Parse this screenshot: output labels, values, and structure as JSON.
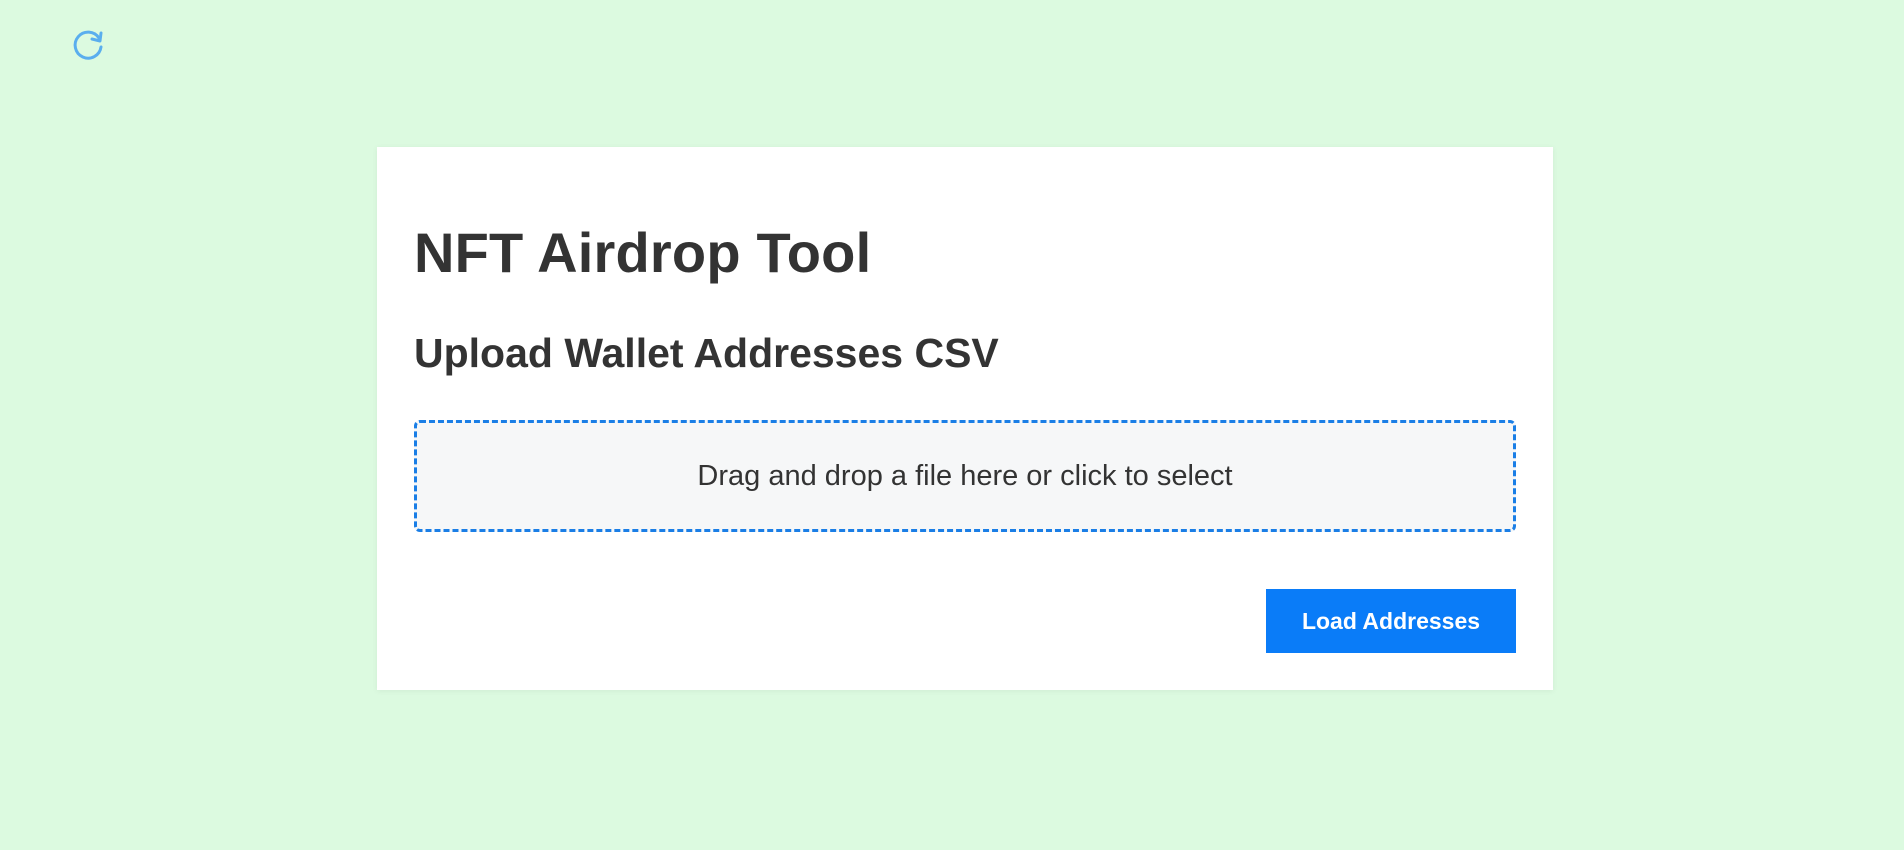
{
  "toolbar": {
    "reload_icon": "reload-icon",
    "reload_color": "#5aaeee"
  },
  "app": {
    "title": "NFT Airdrop Tool",
    "section_title": "Upload Wallet Addresses CSV"
  },
  "upload": {
    "dropzone_text": "Drag and drop a file here or click to select",
    "border_color": "#1a7ee6"
  },
  "actions": {
    "load_label": "Load Addresses",
    "button_color": "#0a7cf8"
  },
  "colors": {
    "background": "#dcfae0",
    "card": "#ffffff",
    "text": "#333333"
  }
}
